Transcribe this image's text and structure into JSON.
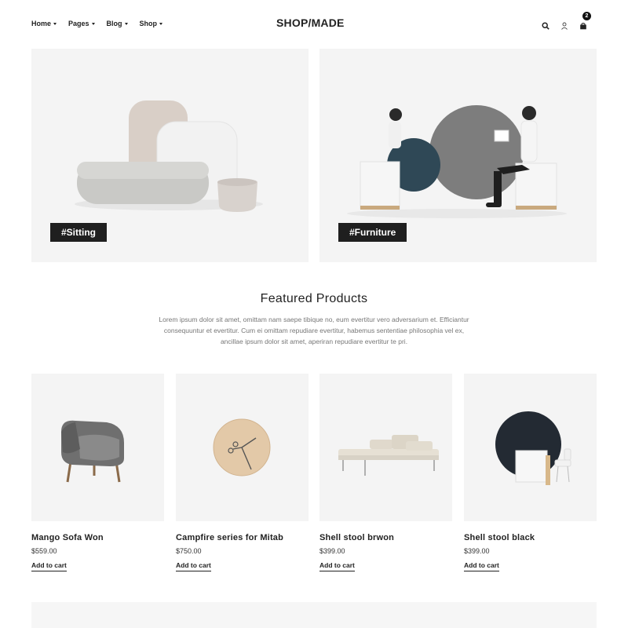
{
  "nav": {
    "items": [
      {
        "label": "Home"
      },
      {
        "label": "Pages"
      },
      {
        "label": "Blog"
      },
      {
        "label": "Shop"
      }
    ]
  },
  "logo": "SHOP/MADE",
  "cart": {
    "count": "2"
  },
  "icons": {
    "search": "search-icon",
    "user": "user-icon",
    "cart": "cart-icon"
  },
  "banners": [
    {
      "tag": "#Sitting"
    },
    {
      "tag": "#Furniture"
    }
  ],
  "featured": {
    "title": "Featured Products",
    "description": "Lorem ipsum dolor sit amet, omittam nam saepe tibique no, eum evertitur vero adversarium et. Efficiantur consequuntur et evertitur. Cum ei omittam repudiare evertitur, habemus sententiae philosophia vel ex, ancillae ipsum dolor sit amet, aperiran repudiare evertitur te pri."
  },
  "products": [
    {
      "name": "Mango Sofa Won",
      "price": "$559.00",
      "cta": "Add to cart"
    },
    {
      "name": "Campfire series for Mitab",
      "price": "$750.00",
      "cta": "Add to cart"
    },
    {
      "name": "Shell stool brwon",
      "price": "$399.00",
      "cta": "Add to cart"
    },
    {
      "name": "Shell stool black",
      "price": "$399.00",
      "cta": "Add to cart"
    }
  ],
  "colors": {
    "accent": "#1f1f1f",
    "panel": "#f4f4f4",
    "muted_text": "#777777"
  }
}
